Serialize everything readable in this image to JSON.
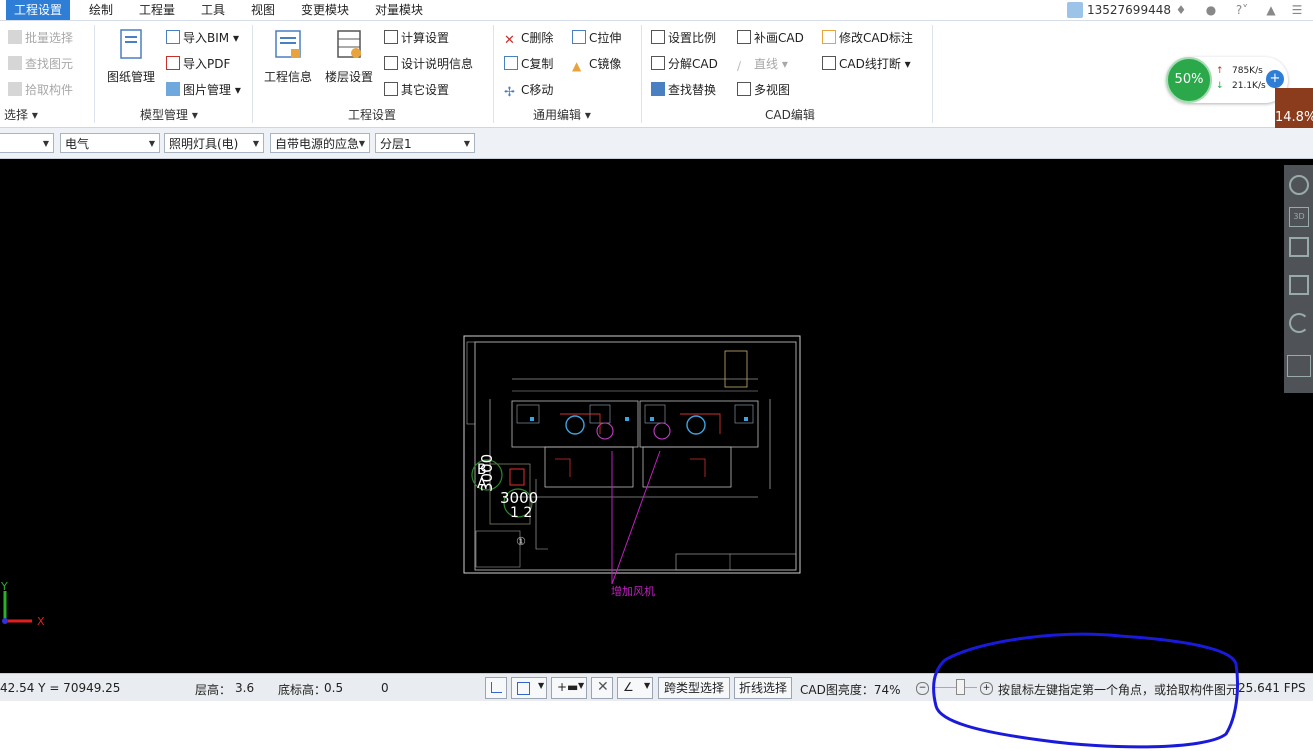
{
  "menu": {
    "items": [
      "工程设置",
      "绘制",
      "工程量",
      "工具",
      "视图",
      "变更模块",
      "对量模块"
    ],
    "active": "工程设置",
    "user": "13527699448"
  },
  "ribbon": {
    "select_group": {
      "batch_select": "批量选择",
      "find_element": "查找图元",
      "pick_component": "拾取构件",
      "label": "选择"
    },
    "model_group": {
      "drawing_manage": "图纸管理",
      "import_bim": "导入BIM",
      "import_pdf": "导入PDF",
      "image_manage": "图片管理",
      "label": "模型管理"
    },
    "project_group": {
      "project_info": "工程信息",
      "floor_settings": "楼层设置",
      "calc_settings": "计算设置",
      "design_notes": "设计说明信息",
      "other_settings": "其它设置",
      "label": "工程设置"
    },
    "edit_group": {
      "c_delete": "C删除",
      "c_copy": "C复制",
      "c_move": "C移动",
      "c_stretch": "C拉伸",
      "c_mirror": "C镜像",
      "label": "通用编辑"
    },
    "cad_group": {
      "set_scale": "设置比例",
      "explode_cad": "分解CAD",
      "find_replace": "查找替换",
      "fill_cad": "补画CAD",
      "line": "直线",
      "multi_view": "多视图",
      "modify_cad_dim": "修改CAD标注",
      "cad_line_break": "CAD线打断",
      "label": "CAD编辑"
    }
  },
  "filters": {
    "f1": "",
    "f2": "电气",
    "f3": "照明灯具(电)",
    "f4": "自带电源的应急",
    "f5": "分层1"
  },
  "network": {
    "percent": "50%",
    "up": "785K/s",
    "down": "21.1K/s"
  },
  "side_percent": "14.8%",
  "canvas": {
    "label_3000_v": "3000",
    "label_3000_h": "3000",
    "label_b": "B",
    "label_a": "A",
    "label_12": "1 2",
    "label_circle": "①",
    "annotation": "增加风机",
    "axis_x": "X",
    "axis_y": "Y"
  },
  "status": {
    "coords": "42.54 Y = 70949.25",
    "floor_height_label": "层高：",
    "floor_height": "3.6",
    "base_elev_label": "底标高：",
    "base_elev": "0.5",
    "zero": "0",
    "cross_type_select": "跨类型选择",
    "polyline_select": "折线选择",
    "cad_brightness": "CAD图亮度：74%",
    "hint": "按鼠标左键指定第一个角点，或拾取构件图元",
    "fps": "25.641 FPS"
  },
  "colors": {
    "accent": "#2e7dd6",
    "canvas": "#000000",
    "highlight_circle": "#1a1adb"
  }
}
